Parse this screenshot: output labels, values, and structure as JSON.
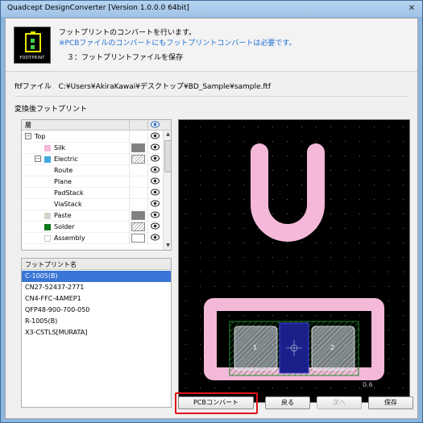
{
  "window": {
    "title": "Quadcept DesignConverter [Version 1.0.0.0 64bit]",
    "close_glyph": "✕"
  },
  "header": {
    "logo_text": "FOOTPRINT",
    "line1": "フットプリントのコンバートを行います。",
    "line2": "※PCBファイルのコンバートにもフットプリントコンバートは必要です。",
    "line3": "３：フットプリントファイルを保存",
    "accent_color": "#1d6fd6"
  },
  "file": {
    "label": "ftfファイル",
    "path": "C:¥Users¥AkiraKawai¥デスクトップ¥BD_Sample¥sample.ftf"
  },
  "group_label": "変換後フットプリント",
  "layers": {
    "header_name": "層",
    "visibility_icon": "eye-icon",
    "rows": [
      {
        "name": "Top",
        "level": 0,
        "expander": "−",
        "swatch": "",
        "color_box": ""
      },
      {
        "name": "Silk",
        "level": 2,
        "expander": "",
        "swatch": "#f4b8d8",
        "color_box": "#808080"
      },
      {
        "name": "Electric",
        "level": 1,
        "expander": "−",
        "swatch": "#41a9e0",
        "color_box": "hatch"
      },
      {
        "name": "Route",
        "level": 3,
        "expander": "",
        "swatch": "",
        "color_box": ""
      },
      {
        "name": "Plane",
        "level": 3,
        "expander": "",
        "swatch": "",
        "color_box": ""
      },
      {
        "name": "PadStack",
        "level": 3,
        "expander": "",
        "swatch": "",
        "color_box": ""
      },
      {
        "name": "ViaStack",
        "level": 3,
        "expander": "",
        "swatch": "",
        "color_box": ""
      },
      {
        "name": "Paste",
        "level": 2,
        "expander": "",
        "swatch": "#d9d2c8",
        "color_box": "#808080"
      },
      {
        "name": "Solder",
        "level": 2,
        "expander": "",
        "swatch": "#0d7a1a",
        "color_box": "hatch"
      },
      {
        "name": "Assembly",
        "level": 2,
        "expander": "",
        "swatch": "#ffffff",
        "color_box": "#ffffff"
      }
    ]
  },
  "footprints": {
    "header": "フットプリント名",
    "items": [
      "C-1005(B)",
      "CN27-52437-2771",
      "CN4-FFC-4AMEP1",
      "QFP48-900-700-050",
      "R-1005(B)",
      "X3-CSTLS[MURATA]"
    ],
    "selected_index": 0
  },
  "preview": {
    "silk_color": "#f4b8d8",
    "pad_labels": [
      "1",
      "2"
    ],
    "corner_label": "0.6"
  },
  "buttons": {
    "pcb_convert": "PCBコンバート",
    "back": "戻る",
    "next": "次へ",
    "save": "保存"
  }
}
